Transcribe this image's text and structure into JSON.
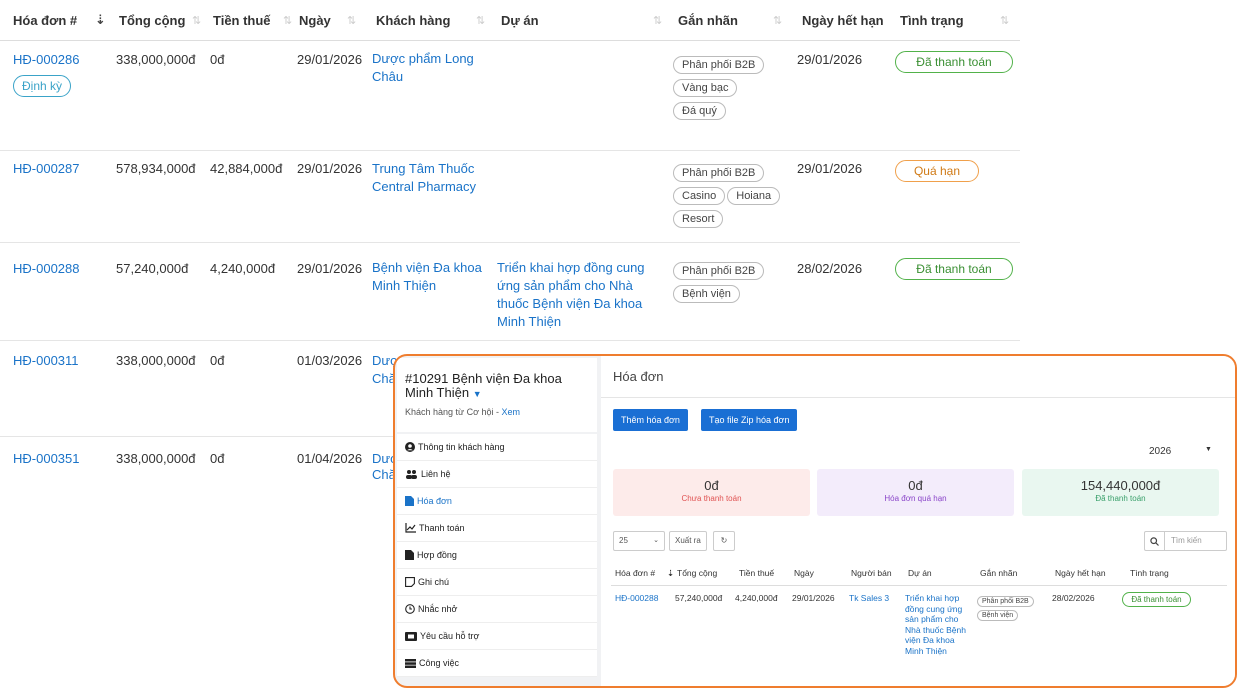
{
  "table": {
    "headers": {
      "invoice": "Hóa đơn #",
      "total": "Tổng cộng",
      "tax": "Tiền thuế",
      "date": "Ngày",
      "customer": "Khách hàng",
      "project": "Dự án",
      "tags": "Gắn nhãn",
      "due": "Ngày hết hạn",
      "status": "Tình trạng"
    },
    "rows": [
      {
        "invoice": "HĐ-000286",
        "recurring": "Định kỳ",
        "total": "338,000,000đ",
        "tax": "0đ",
        "date": "29/01/2026",
        "customer": "Dược phẩm Long Châu",
        "project": "",
        "tags": [
          "Phân phối B2B",
          "Vàng bạc",
          "Đá quý"
        ],
        "due": "29/01/2026",
        "status": "Đã thanh toán"
      },
      {
        "invoice": "HĐ-000287",
        "total": "578,934,000đ",
        "tax": "42,884,000đ",
        "date": "29/01/2026",
        "customer": "Trung Tâm Thuốc Central Pharmacy",
        "project": "",
        "tags": [
          "Phân phối B2B",
          "Casino",
          "Hoiana",
          "Resort"
        ],
        "due": "29/01/2026",
        "status": "Quá hạn"
      },
      {
        "invoice": "HĐ-000288",
        "total": "57,240,000đ",
        "tax": "4,240,000đ",
        "date": "29/01/2026",
        "customer": "Bệnh viện Đa khoa Minh Thiện",
        "project": "Triển khai hợp đồng cung ứng sản phẩm cho Nhà thuốc Bệnh viện Đa khoa Minh Thiện",
        "tags": [
          "Phân phối B2B",
          "Bệnh viện"
        ],
        "due": "28/02/2026",
        "status": "Đã thanh toán"
      },
      {
        "invoice": "HĐ-000311",
        "total": "338,000,000đ",
        "tax": "0đ",
        "date": "01/03/2026",
        "customer": "Dược",
        "customer2": "Chă"
      },
      {
        "invoice": "HĐ-000351",
        "total": "338,000,000đ",
        "tax": "0đ",
        "date": "01/04/2026",
        "customer": "Dượ",
        "customer2": "Chă"
      }
    ]
  },
  "panel": {
    "customer_title": "#10291 Bệnh viện Đa khoa Minh Thiện",
    "customer_sub": "Khách hàng từ Cơ hội - ",
    "customer_sub_link": "Xem",
    "menu": [
      {
        "label": "Thông tin khách hàng",
        "icon": "user-circle-icon"
      },
      {
        "label": "Liên hệ",
        "icon": "users-icon"
      },
      {
        "label": "Hóa đơn",
        "icon": "file-icon"
      },
      {
        "label": "Thanh toán",
        "icon": "line-chart-icon"
      },
      {
        "label": "Hợp đồng",
        "icon": "file-icon"
      },
      {
        "label": "Ghi chú",
        "icon": "note-icon"
      },
      {
        "label": "Nhắc nhở",
        "icon": "clock-icon"
      },
      {
        "label": "Yêu cầu hỗ trợ",
        "icon": "ticket-icon"
      },
      {
        "label": "Công việc",
        "icon": "tasks-icon"
      }
    ],
    "section_title": "Hóa đơn",
    "add_button": "Thêm hóa đơn",
    "zip_button": "Tạo file Zip hóa đơn",
    "year": "2026",
    "stats": {
      "unpaid": {
        "value": "0đ",
        "label": "Chưa thanh toán"
      },
      "overdue": {
        "value": "0đ",
        "label": "Hóa đơn quá hạn"
      },
      "paid": {
        "value": "154,440,000đ",
        "label": "Đã thanh toán"
      }
    },
    "page_size": "25",
    "export": "Xuất ra",
    "search_placeholder": "Tìm kiến",
    "table_headers": {
      "invoice": "Hóa đơn #",
      "total": "Tổng cộng",
      "tax": "Tiền thuế",
      "date": "Ngày",
      "seller": "Người bán",
      "project": "Dự án",
      "tags": "Gắn nhãn",
      "due": "Ngày hết hạn",
      "status": "Tình trạng"
    },
    "row": {
      "invoice": "HĐ-000288",
      "total": "57,240,000đ",
      "tax": "4,240,000đ",
      "date": "29/01/2026",
      "seller": "Tk Sales 3",
      "project": "Triển khai hợp đồng cung ứng sản phẩm cho Nhà thuốc Bệnh viện Đa khoa Minh Thiện",
      "tags": [
        "Phân phối B2B",
        "Bệnh viện"
      ],
      "due": "28/02/2026",
      "status": "Đã thanh toán"
    }
  },
  "colors": {
    "link": "#1a73c8",
    "paid": "#52b24a",
    "overdue": "#f0a04b",
    "highlight_border": "#ef7d2e",
    "primary_button": "#1a6fd4"
  }
}
